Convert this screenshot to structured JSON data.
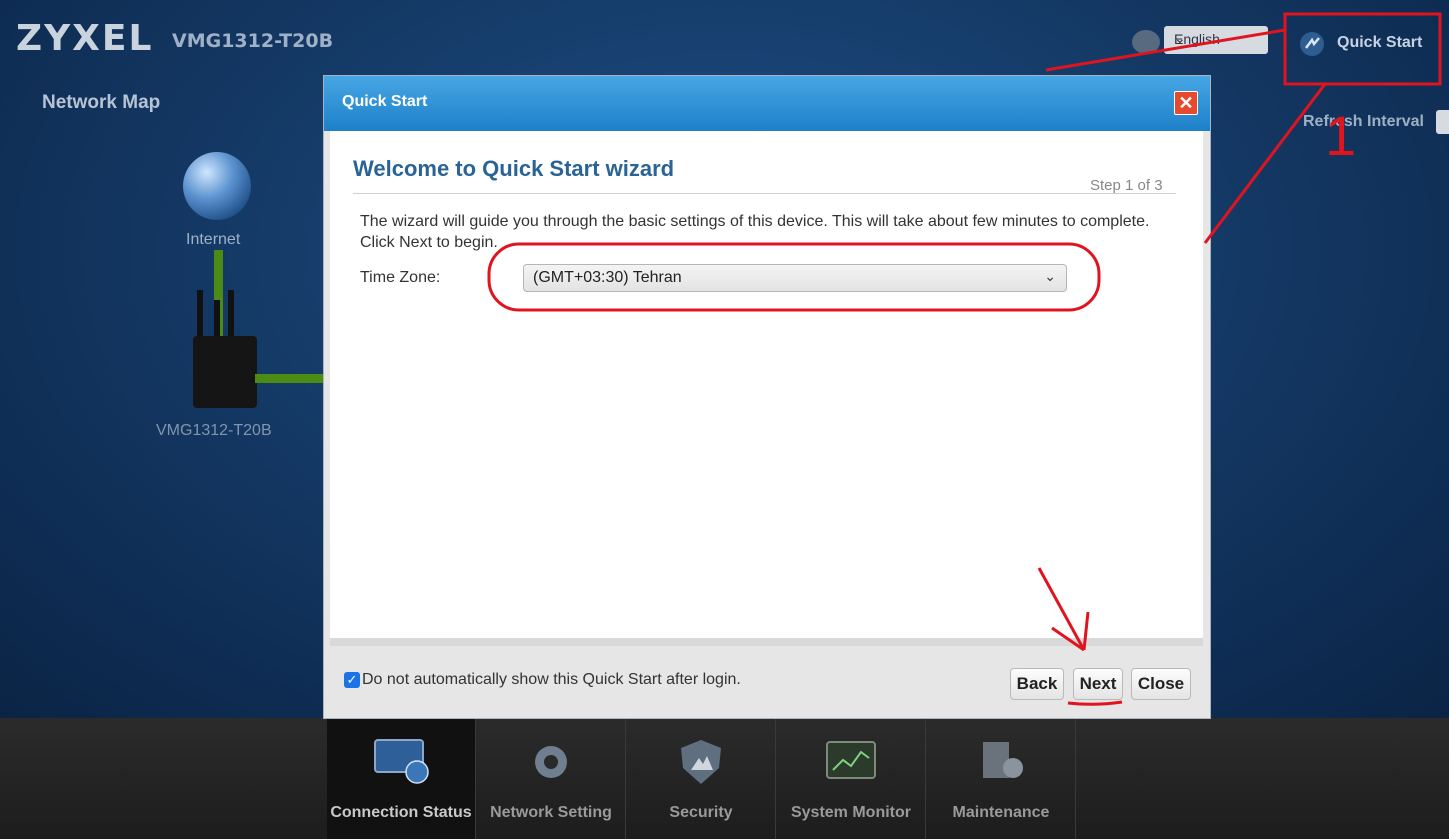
{
  "header": {
    "brand": "ZYXEL",
    "model": "VMG1312-T20B",
    "language_selected": "English",
    "quick_start_label": "Quick Start",
    "refresh_interval_label": "Refresh Interval"
  },
  "network_map": {
    "title": "Network Map",
    "internet_label": "Internet",
    "device_label": "VMG1312-T20B"
  },
  "modal": {
    "title": "Quick Start",
    "wizard_title": "Welcome to Quick Start wizard",
    "step_text": "Step 1 of 3",
    "description": "The wizard will guide you through the basic settings of this device. This will take about few minutes to complete. Click Next to begin.",
    "time_zone_label": "Time Zone:",
    "time_zone_value": "(GMT+03:30) Tehran",
    "checkbox_label": "Do not automatically show this Quick Start after login.",
    "checkbox_checked": true,
    "buttons": {
      "back": "Back",
      "next": "Next",
      "close": "Close"
    }
  },
  "bottom_nav": {
    "items": [
      {
        "label": "Connection Status",
        "icon": "monitor-globe-icon",
        "active": true
      },
      {
        "label": "Network Setting",
        "icon": "gear-icon",
        "active": false
      },
      {
        "label": "Security",
        "icon": "shield-icon",
        "active": false
      },
      {
        "label": "System Monitor",
        "icon": "chart-monitor-icon",
        "active": false
      },
      {
        "label": "Maintenance",
        "icon": "tools-icon",
        "active": false
      }
    ]
  },
  "annotations": {
    "step_number": "1",
    "color": "#e0141e"
  },
  "colors": {
    "header_blue": "#1d80c8",
    "title_blue": "#2a6496",
    "close_red": "#e64a2e",
    "link_green": "#4c8c14"
  }
}
